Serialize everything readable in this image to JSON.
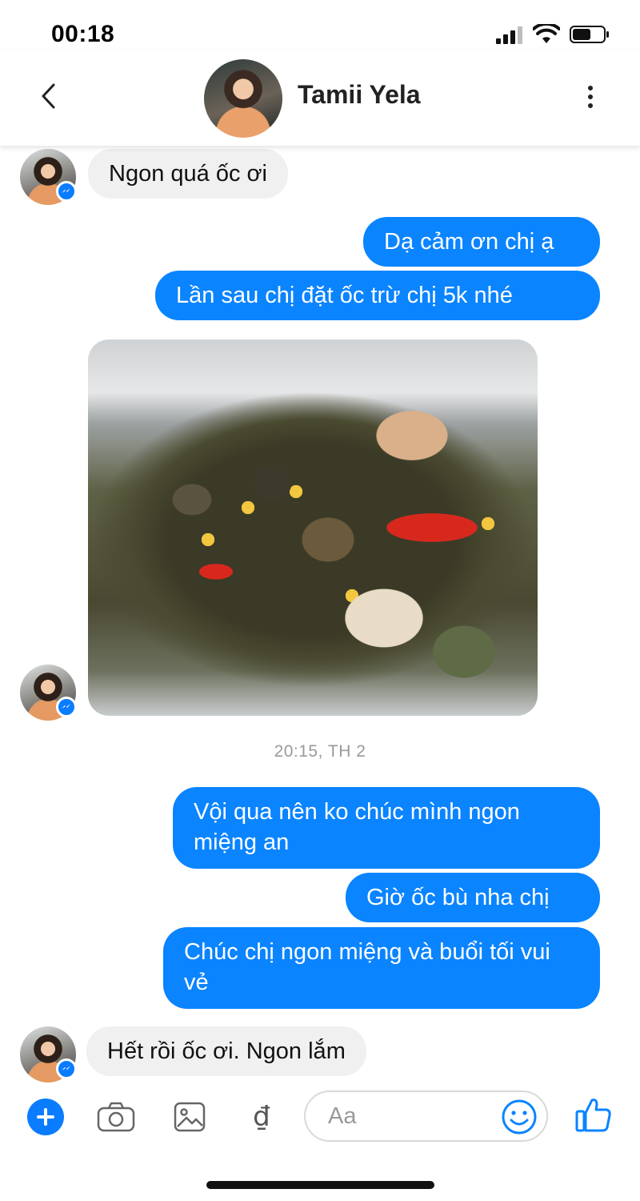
{
  "status_bar": {
    "time": "00:18"
  },
  "header": {
    "contact_name": "Tamii Yela"
  },
  "messages": [
    {
      "side": "in",
      "text": "Ngon quá ốc ơi"
    },
    {
      "side": "out",
      "text": "Dạ cảm ơn chị ạ"
    },
    {
      "side": "out",
      "text": "Lần sau chị đặt ốc trừ chị 5k nhé"
    },
    {
      "side": "in",
      "type": "photo",
      "icon": "snail-dish-photo"
    },
    {
      "side": "out",
      "text": "Vội qua nên ko chúc mình ngon miệng an"
    },
    {
      "side": "out",
      "text": "Giờ ốc bù nha chị"
    },
    {
      "side": "out",
      "text": "Chúc chị ngon miệng và buổi tối vui vẻ"
    },
    {
      "side": "in",
      "text": "Hết rồi ốc ơi. Ngon lắm"
    }
  ],
  "timestamp": "20:15, TH 2",
  "composer": {
    "placeholder": "Aa",
    "currency_symbol": "₫"
  },
  "colors": {
    "accent": "#0a84ff",
    "incoming_bubble": "#f0f0f0",
    "timestamp": "#9a9a9a"
  }
}
